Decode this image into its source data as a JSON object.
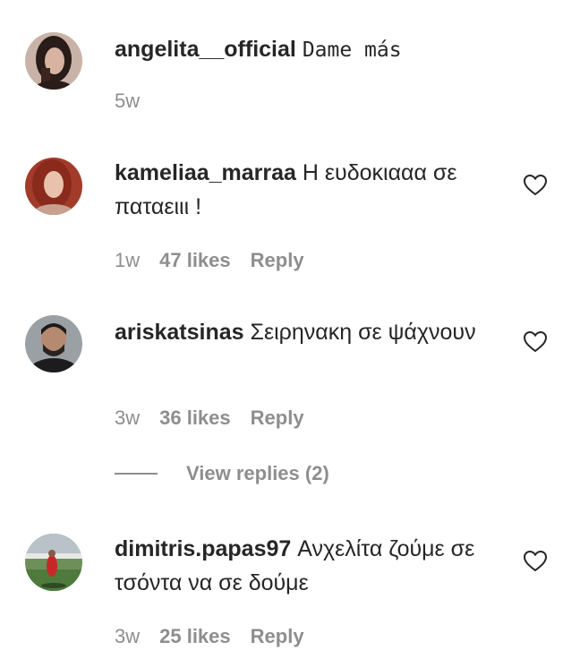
{
  "comments": [
    {
      "username": "angelita__official",
      "text": "Dame más",
      "time": "5w",
      "likes": "",
      "reply_label": "",
      "icon": "heart-outline-icon"
    },
    {
      "username": "kameliaa_marraa",
      "text": "Η ευδοκιααα σε παταειιι !",
      "time": "1w",
      "likes": "47 likes",
      "reply_label": "Reply",
      "icon": "heart-outline-icon"
    },
    {
      "username": "ariskatsinas",
      "text": "Σειρηνακη σε ψάχνουν",
      "time": "3w",
      "likes": "36 likes",
      "reply_label": "Reply",
      "icon": "heart-outline-icon"
    },
    {
      "username": "dimitris.papas97",
      "text": "Ανχελίτα ζούμε σε τσόντα να σε δούμε",
      "time": "3w",
      "likes": "25 likes",
      "reply_label": "Reply",
      "icon": "heart-outline-icon"
    }
  ],
  "view_replies": "View replies (2)",
  "colors": {
    "text": "#262626",
    "secondary": "#8e8e8e"
  }
}
